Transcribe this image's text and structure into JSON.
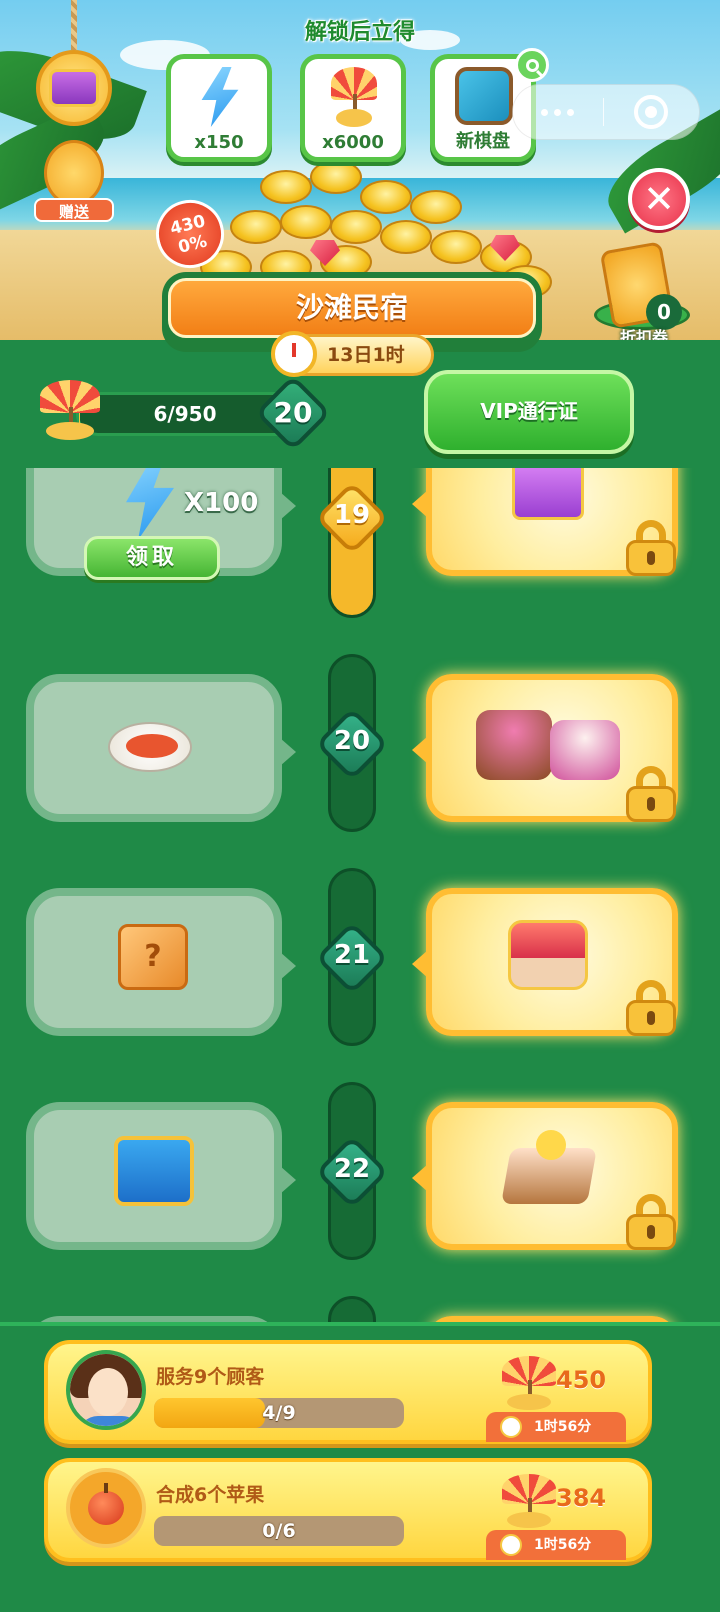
{
  "header": {
    "unlock_title": "解锁后立得",
    "rewards": [
      {
        "icon": "energy-bolt-icon",
        "label": "x150"
      },
      {
        "icon": "beach-umbrella-icon",
        "label": "x6000"
      },
      {
        "icon": "game-board-icon",
        "label": "新棋盘"
      }
    ],
    "gift_label": "赠送",
    "percent_badge": "4300%",
    "coupon_count": "0",
    "coupon_label": "折扣券",
    "event_title": "沙滩民宿",
    "timer": "13日1时"
  },
  "progress": {
    "value_text": "6/950",
    "fraction": 0.0063,
    "level": "20"
  },
  "vip_button": "VIP通行证",
  "track": [
    {
      "level": "19",
      "free_item": "energy-bolt-icon",
      "free_qty": "X100",
      "claim_label": "领取",
      "vip_item": "purple-chest-icon",
      "active": true
    },
    {
      "level": "20",
      "free_item": "omelette-dish-icon",
      "vip_item": "ice-cream-desserts-icon",
      "active": false
    },
    {
      "level": "21",
      "free_item": "mystery-box-icon",
      "vip_item": "red-chest-icon",
      "active": false
    },
    {
      "level": "22",
      "free_item": "blue-chest-icon",
      "vip_item": "flower-cake-icon",
      "active": false
    }
  ],
  "tasks": [
    {
      "name": "服务9个顾客",
      "progress_text": "4/9",
      "fraction": 0.444,
      "reward": "450",
      "timer": "1时56分",
      "icon": "girl-avatar"
    },
    {
      "name": "合成6个苹果",
      "progress_text": "0/6",
      "fraction": 0,
      "reward": "384",
      "timer": "1时56分",
      "icon": "apple-icon"
    }
  ],
  "colors": {
    "background": "#1f8a47",
    "accent_gold": "#ffbd32",
    "button_green": "#46b534"
  }
}
